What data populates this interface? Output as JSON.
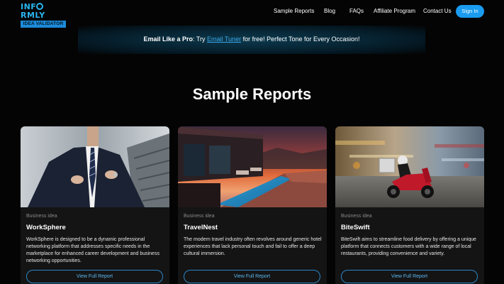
{
  "logo": {
    "top_before_o": "INF",
    "top_after_o": "RMLY",
    "bottom": "IDEA VALIDATOR"
  },
  "nav": {
    "items": [
      "Sample Reports",
      "Blog",
      "FAQs",
      "Affiliate Program",
      "Contact Us"
    ],
    "signin": "Sign In"
  },
  "promo": {
    "lead": "Email Like a Pro",
    "pre": ": Try ",
    "link": "Email Tuner",
    "post": " for free! Perfect Tone for Every Occasion!"
  },
  "section_title": "Sample Reports",
  "cards": [
    {
      "category": "Business idea",
      "title": "WorkSphere",
      "description": "WorkSphere is designed to be a dynamic professional networking platform that addresses specific needs in the marketplace for enhanced career development and business networking opportunities.",
      "button": "View Full Report",
      "image": "businessman-image"
    },
    {
      "category": "Business idea",
      "title": "TravelNest",
      "description": "The modern travel industry often revolves around generic hotel experiences that lack personal touch and fail to offer a deep cultural immersion.",
      "button": "View Full Report",
      "image": "poolside-sunset-image"
    },
    {
      "category": "Business idea",
      "title": "BiteSwift",
      "description": "BiteSwift aims to streamline food delivery by offering a unique platform that connects customers with a wide range of local restaurants, providing convenience and variety.",
      "button": "View Full Report",
      "image": "delivery-scooter-image"
    }
  ],
  "colors": {
    "accent": "#1a9bf0",
    "link": "#3aa7e8",
    "card_bg": "#141414",
    "page_bg": "#040404"
  }
}
